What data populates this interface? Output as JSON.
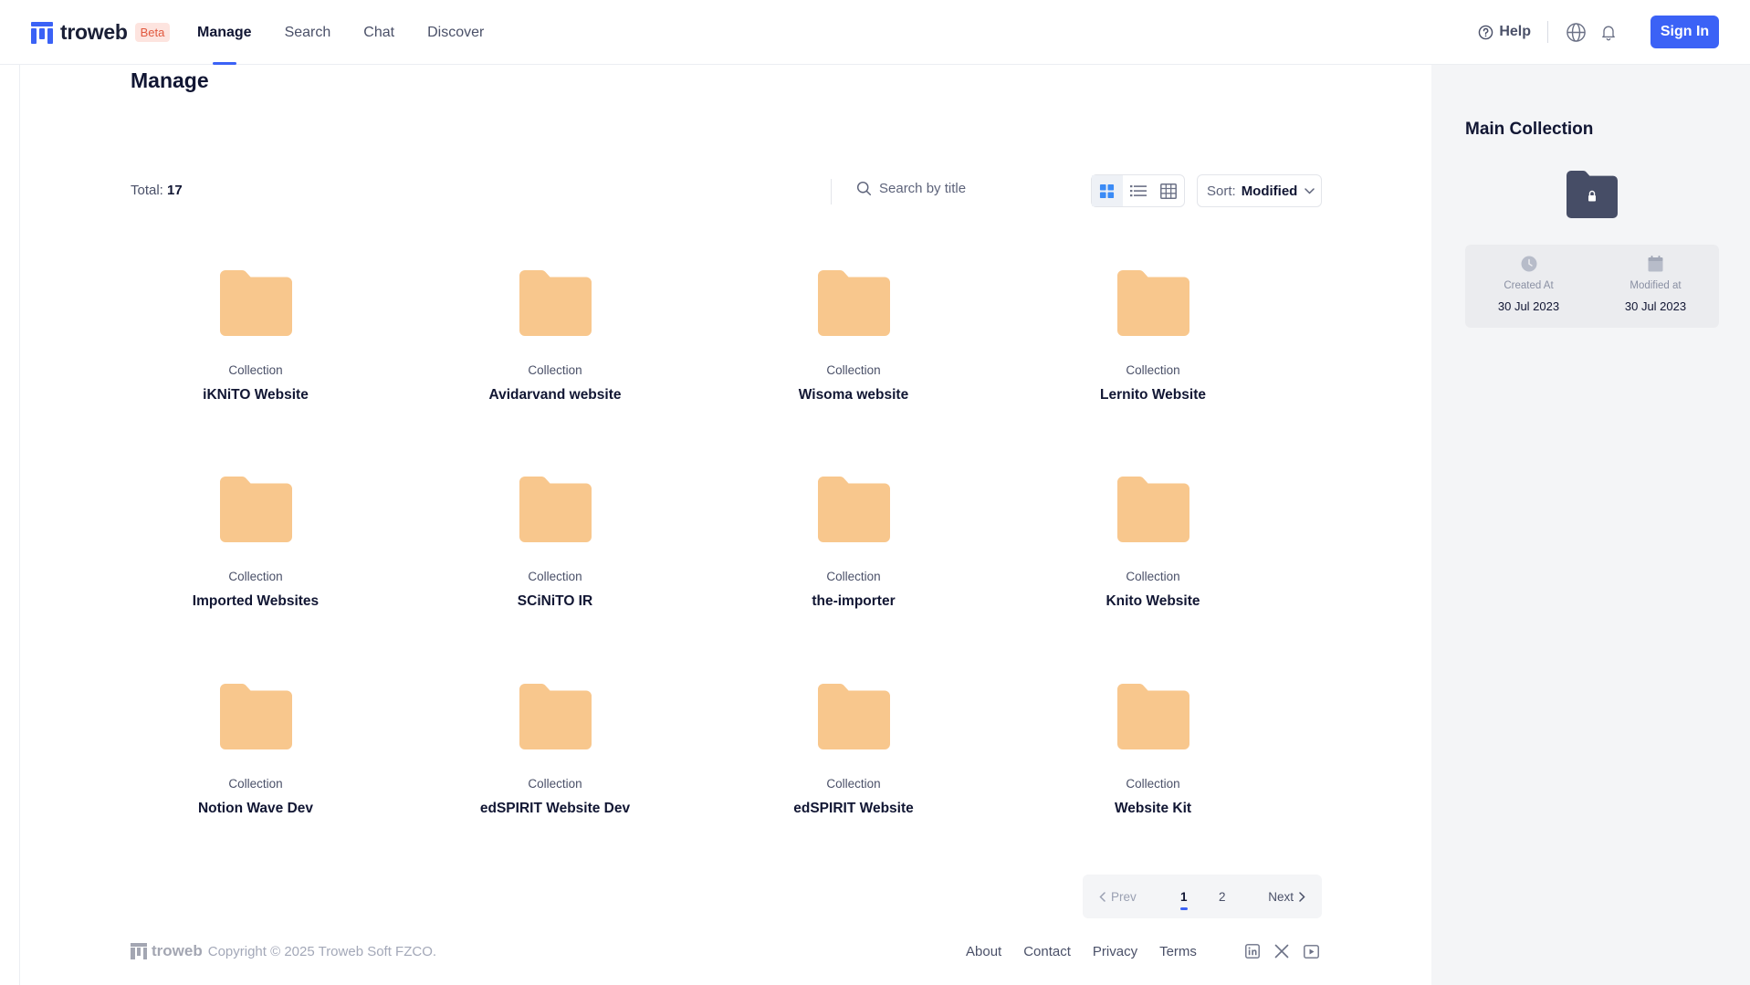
{
  "brand": {
    "name": "troweb",
    "badge": "Beta",
    "accent": "#3b62f6"
  },
  "nav": {
    "items": [
      {
        "label": "Manage",
        "active": true
      },
      {
        "label": "Search",
        "active": false
      },
      {
        "label": "Chat",
        "active": false
      },
      {
        "label": "Discover",
        "active": false
      }
    ],
    "help_label": "Help",
    "sign_in_label": "Sign In",
    "icons": [
      "help-circle-icon",
      "globe-icon",
      "bell-icon"
    ]
  },
  "main": {
    "title": "Manage",
    "total_label": "Total:",
    "total_value": "17",
    "search_placeholder": "Search by title",
    "view_modes": [
      "grid",
      "list",
      "table"
    ],
    "active_view": "grid",
    "sort_label": "Sort:",
    "sort_value": "Modified",
    "folder_color": "#f8c78d",
    "items": [
      {
        "type": "Collection",
        "title": "iKNiTO Website"
      },
      {
        "type": "Collection",
        "title": "Avidarvand website"
      },
      {
        "type": "Collection",
        "title": "Wisoma website"
      },
      {
        "type": "Collection",
        "title": "Lernito Website"
      },
      {
        "type": "Collection",
        "title": "Imported Websites"
      },
      {
        "type": "Collection",
        "title": "SCiNiTO IR"
      },
      {
        "type": "Collection",
        "title": "the-importer"
      },
      {
        "type": "Collection",
        "title": "Knito Website"
      },
      {
        "type": "Collection",
        "title": "Notion Wave Dev"
      },
      {
        "type": "Collection",
        "title": "edSPIRIT Website Dev"
      },
      {
        "type": "Collection",
        "title": "edSPIRIT Website"
      },
      {
        "type": "Collection",
        "title": "Website Kit"
      }
    ]
  },
  "pagination": {
    "prev_label": "Prev",
    "next_label": "Next",
    "pages": [
      "1",
      "2"
    ],
    "current": "1"
  },
  "footer": {
    "logo_text": "troweb",
    "copyright": "Copyright © 2025 Troweb Soft FZCO.",
    "links": [
      "About",
      "Contact",
      "Privacy",
      "Terms"
    ],
    "social_icons": [
      "linkedin-icon",
      "x-icon",
      "youtube-icon"
    ]
  },
  "side_panel": {
    "title": "Main Collection",
    "folder_color": "#464d66",
    "created_label": "Created At",
    "created_value": "30 Jul 2023",
    "modified_label": "Modified at",
    "modified_value": "30 Jul 2023"
  }
}
